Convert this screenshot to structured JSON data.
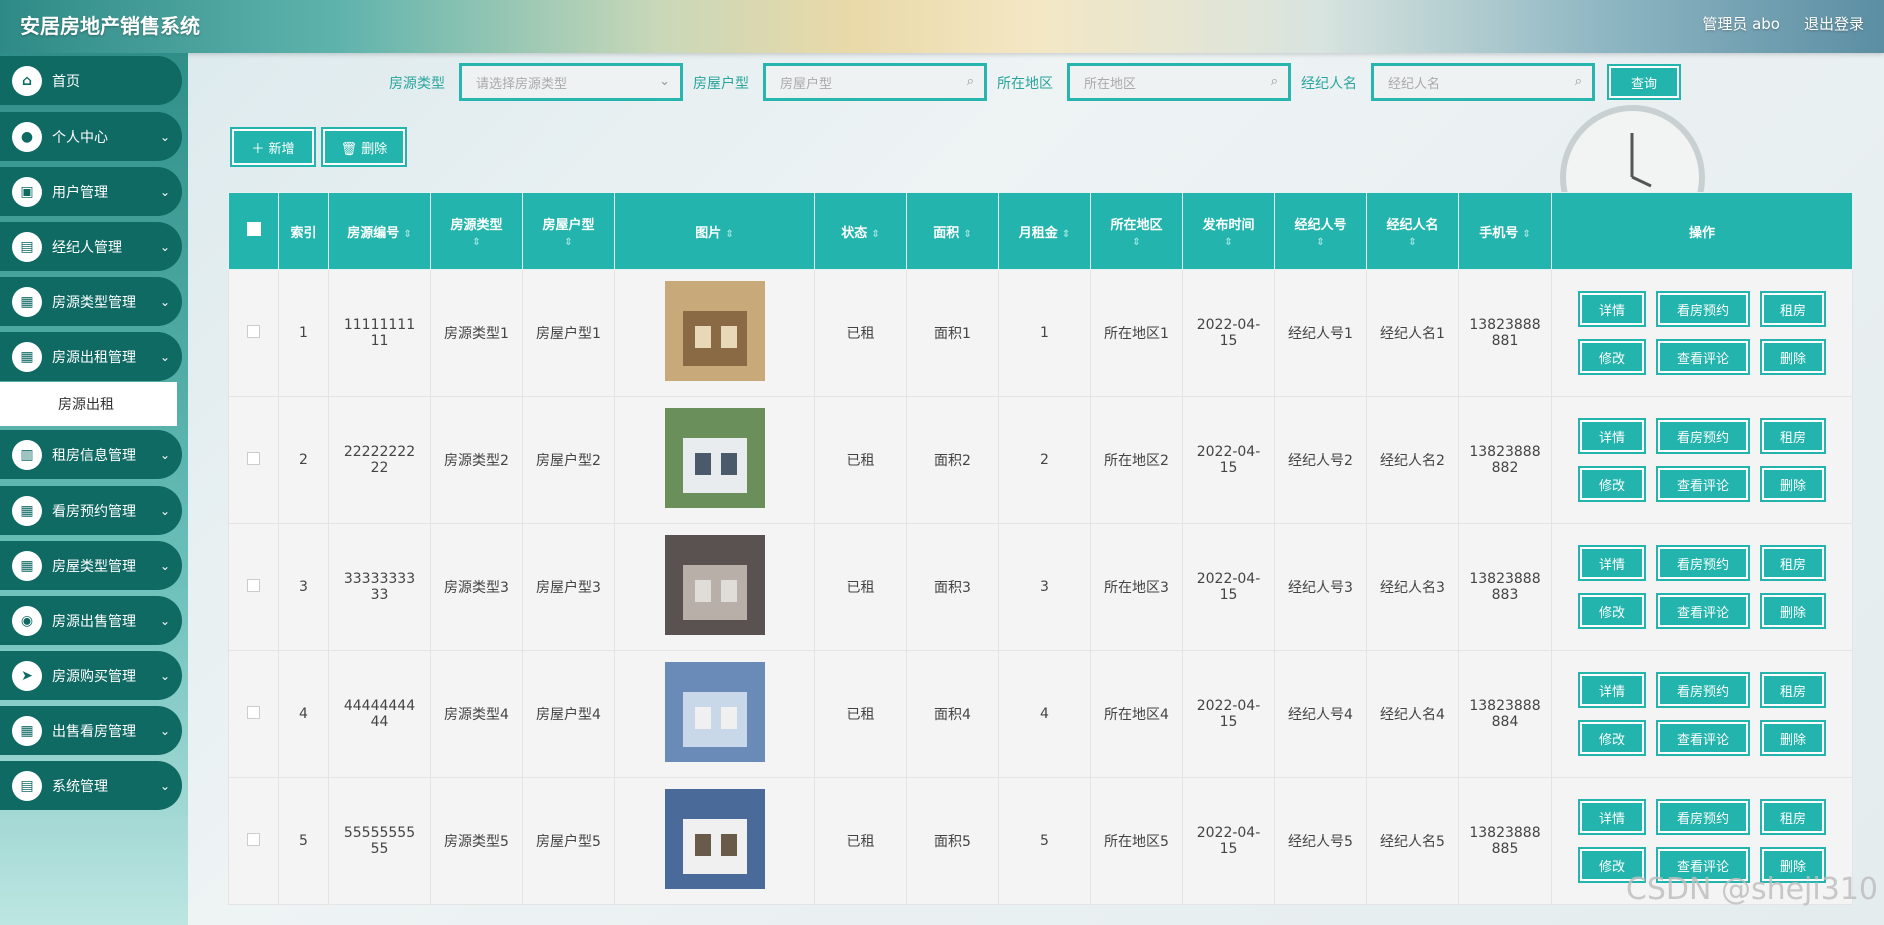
{
  "header": {
    "title": "安居房地产销售系统",
    "user": "管理员 abo",
    "logout": "退出登录"
  },
  "sidebar": {
    "items": [
      {
        "label": "首页",
        "icon": "home-icon",
        "glyph": "⌂",
        "chev": ""
      },
      {
        "label": "个人中心",
        "icon": "user-icon",
        "glyph": "●",
        "chev": "⌄"
      },
      {
        "label": "用户管理",
        "icon": "briefcase-icon",
        "glyph": "▣",
        "chev": "⌄"
      },
      {
        "label": "经纪人管理",
        "icon": "wallet-icon",
        "glyph": "▤",
        "chev": "⌄"
      },
      {
        "label": "房源类型管理",
        "icon": "grid-icon",
        "glyph": "▦",
        "chev": "⌄"
      },
      {
        "label": "房源出租管理",
        "icon": "grid-icon",
        "glyph": "▦",
        "chev": "⌄"
      },
      {
        "label": "租房信息管理",
        "icon": "printer-icon",
        "glyph": "▥",
        "chev": "⌄"
      },
      {
        "label": "看房预约管理",
        "icon": "grid-icon",
        "glyph": "▦",
        "chev": "⌄"
      },
      {
        "label": "房屋类型管理",
        "icon": "grid-icon",
        "glyph": "▦",
        "chev": "⌄"
      },
      {
        "label": "房源出售管理",
        "icon": "location-icon",
        "glyph": "◉",
        "chev": "⌄"
      },
      {
        "label": "房源购买管理",
        "icon": "send-icon",
        "glyph": "➤",
        "chev": "⌄"
      },
      {
        "label": "出售看房管理",
        "icon": "grid-icon",
        "glyph": "▦",
        "chev": "⌄"
      },
      {
        "label": "系统管理",
        "icon": "clipboard-icon",
        "glyph": "▤",
        "chev": "⌄"
      }
    ],
    "submenu": "房源出租"
  },
  "search": {
    "type_label": "房源类型",
    "type_placeholder": "请选择房源类型",
    "layout_label": "房屋户型",
    "layout_placeholder": "房屋户型",
    "region_label": "所在地区",
    "region_placeholder": "所在地区",
    "agent_label": "经纪人名",
    "agent_placeholder": "经纪人名",
    "query": "查询"
  },
  "toolbar": {
    "add": "＋ 新增",
    "delete": "🗑 删除"
  },
  "table": {
    "headers": [
      "索引",
      "房源编号",
      "房源类型",
      "房屋户型",
      "图片",
      "状态",
      "面积",
      "月租金",
      "所在地区",
      "发布时间",
      "经纪人号",
      "经纪人名",
      "手机号",
      "操作"
    ],
    "rows": [
      {
        "idx": "1",
        "code": "1111111111",
        "type": "房源类型1",
        "layout": "房屋户型1",
        "status": "已租",
        "area": "面积1",
        "rent": "1",
        "region": "所在地区1",
        "date": "2022-04-15",
        "agent_no": "经纪人号1",
        "agent_name": "经纪人名1",
        "phone": "13823888881"
      },
      {
        "idx": "2",
        "code": "2222222222",
        "type": "房源类型2",
        "layout": "房屋户型2",
        "status": "已租",
        "area": "面积2",
        "rent": "2",
        "region": "所在地区2",
        "date": "2022-04-15",
        "agent_no": "经纪人号2",
        "agent_name": "经纪人名2",
        "phone": "13823888882"
      },
      {
        "idx": "3",
        "code": "3333333333",
        "type": "房源类型3",
        "layout": "房屋户型3",
        "status": "已租",
        "area": "面积3",
        "rent": "3",
        "region": "所在地区3",
        "date": "2022-04-15",
        "agent_no": "经纪人号3",
        "agent_name": "经纪人名3",
        "phone": "13823888883"
      },
      {
        "idx": "4",
        "code": "4444444444",
        "type": "房源类型4",
        "layout": "房屋户型4",
        "status": "已租",
        "area": "面积4",
        "rent": "4",
        "region": "所在地区4",
        "date": "2022-04-15",
        "agent_no": "经纪人号4",
        "agent_name": "经纪人名4",
        "phone": "13823888884"
      },
      {
        "idx": "5",
        "code": "5555555555",
        "type": "房源类型5",
        "layout": "房屋户型5",
        "status": "已租",
        "area": "面积5",
        "rent": "5",
        "region": "所在地区5",
        "date": "2022-04-15",
        "agent_no": "经纪人号5",
        "agent_name": "经纪人名5",
        "phone": "13823888885"
      }
    ],
    "ops": [
      "详情",
      "看房预约",
      "租房",
      "修改",
      "查看评论",
      "删除"
    ]
  },
  "watermark": "CSDN @sheji310",
  "colors": {
    "accent": "#23b5ad",
    "sidebar_item": "#0f6a64"
  }
}
